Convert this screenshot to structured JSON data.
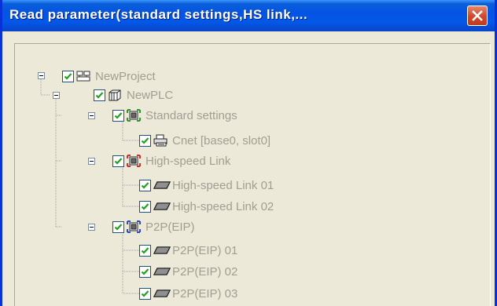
{
  "window": {
    "title": "Read parameter(standard settings,HS link,..."
  },
  "tree": {
    "project": {
      "label": "NewProject",
      "icon": "project-icon",
      "checked": true
    },
    "plc": {
      "label": "NewPLC",
      "icon": "plc-icon",
      "checked": true
    },
    "standard": {
      "label": "Standard settings",
      "icon": "standard-settings-icon",
      "checked": true
    },
    "cnet": {
      "label": "Cnet [base0, slot0]",
      "icon": "printer-module-icon",
      "checked": true
    },
    "hslink": {
      "label": "High-speed Link",
      "icon": "highspeed-link-icon",
      "checked": true
    },
    "hslink01": {
      "label": "High-speed Link 01",
      "icon": "link-block-icon",
      "checked": true
    },
    "hslink02": {
      "label": "High-speed Link 02",
      "icon": "link-block-icon",
      "checked": true
    },
    "p2p": {
      "label": "P2P(EIP)",
      "icon": "p2p-icon",
      "checked": true
    },
    "p2p01": {
      "label": "P2P(EIP) 01",
      "icon": "link-block-icon",
      "checked": true
    },
    "p2p02": {
      "label": "P2P(EIP) 02",
      "icon": "link-block-icon",
      "checked": true
    },
    "p2p03": {
      "label": "P2P(EIP) 03",
      "icon": "link-block-icon",
      "checked": true
    }
  },
  "colors": {
    "titlebar": "#0554e3",
    "close": "#d2462b",
    "panel": "#ece9d8",
    "disabled_text": "#a19e92",
    "checkmark": "#21a121"
  }
}
